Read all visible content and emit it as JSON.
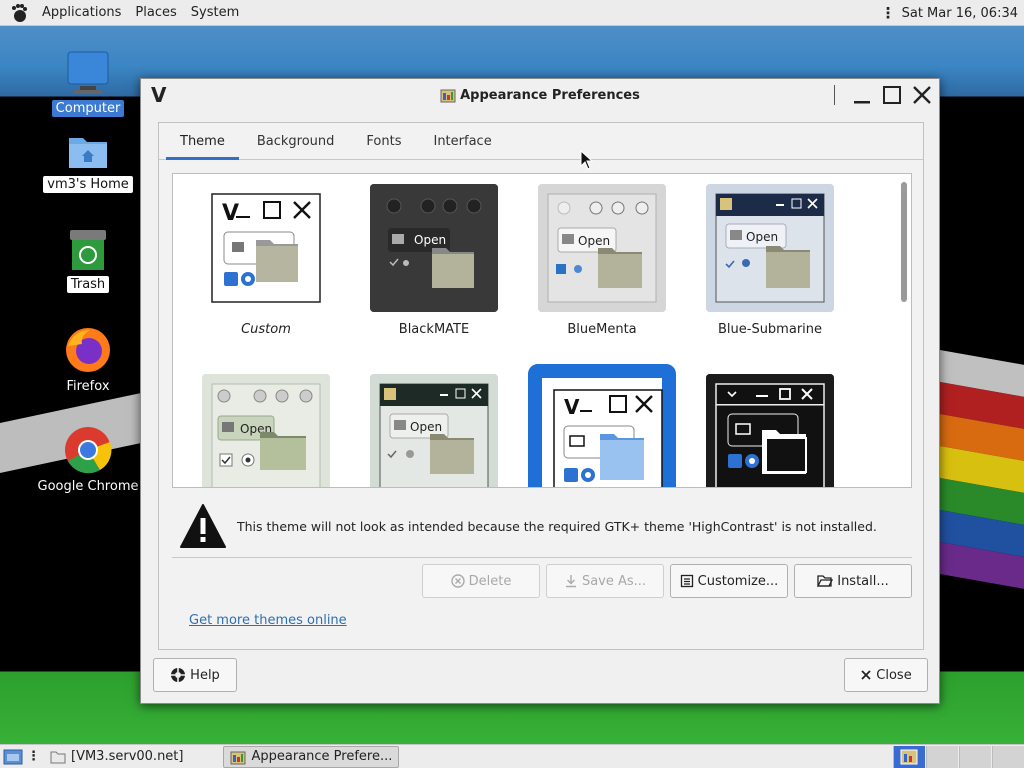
{
  "top_panel": {
    "menus": [
      "Applications",
      "Places",
      "System"
    ],
    "clock": "Sat Mar 16, 06:34"
  },
  "desktop_icons": [
    {
      "label": "Computer",
      "icon": "computer-icon",
      "state": "selected"
    },
    {
      "label": "vm3's Home",
      "icon": "home-folder-icon",
      "state": "white"
    },
    {
      "label": "Trash",
      "icon": "trash-icon",
      "state": "white"
    },
    {
      "label": "Firefox",
      "icon": "firefox-icon",
      "state": "dark"
    },
    {
      "label": "Google Chrome",
      "icon": "chrome-icon",
      "state": "dark"
    }
  ],
  "window": {
    "title": "Appearance Preferences",
    "app_letter": "V",
    "tabs": [
      "Theme",
      "Background",
      "Fonts",
      "Interface"
    ],
    "active_tab": "Theme",
    "themes": [
      {
        "name": "Custom",
        "italic": true,
        "style": "custom"
      },
      {
        "name": "BlackMATE",
        "style": "blackmate"
      },
      {
        "name": "BlueMenta",
        "style": "bluementa"
      },
      {
        "name": "Blue-Submarine",
        "style": "bluesub"
      },
      {
        "name": "",
        "style": "greenish"
      },
      {
        "name": "",
        "style": "greenish2"
      },
      {
        "name": "",
        "style": "highcontrast",
        "selected": true
      },
      {
        "name": "",
        "style": "highcontrastinv"
      }
    ],
    "preview_open_label": "Open",
    "warning_text": "This theme will not look as intended because the required GTK+ theme 'HighContrast' is not installed.",
    "buttons": {
      "delete": "Delete",
      "save_as": "Save As...",
      "customize": "Customize...",
      "install": "Install..."
    },
    "more_themes_link": "Get more themes online",
    "help": "Help",
    "close": "Close"
  },
  "taskbar": {
    "tasks": [
      "[VM3.serv00.net]",
      "Appearance Prefere..."
    ]
  },
  "colors": {
    "accent": "#1e6fd6",
    "link": "#2f6fad"
  }
}
